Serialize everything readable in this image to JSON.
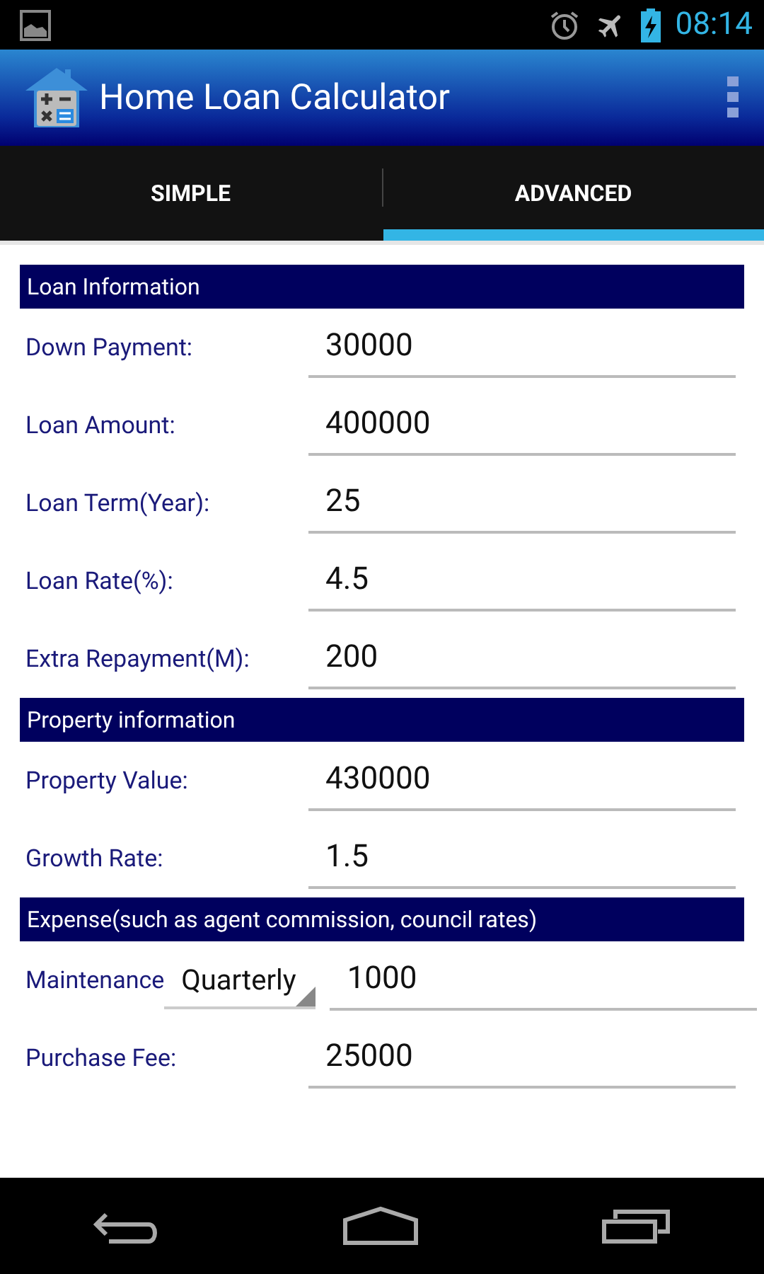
{
  "status_bar": {
    "time": "08:14"
  },
  "app_bar": {
    "title": "Home Loan Calculator"
  },
  "tabs": [
    {
      "label": "SIMPLE",
      "selected": false
    },
    {
      "label": "ADVANCED",
      "selected": true
    }
  ],
  "sections": [
    {
      "title": "Loan Information",
      "rows": [
        {
          "kind": "input",
          "label": "Down Payment:",
          "value": "30000"
        },
        {
          "kind": "input",
          "label": "Loan Amount:",
          "value": "400000"
        },
        {
          "kind": "input",
          "label": "Loan Term(Year):",
          "value": "25"
        },
        {
          "kind": "input",
          "label": "Loan Rate(%):",
          "value": "4.5"
        },
        {
          "kind": "input",
          "label": "Extra Repayment(M):",
          "value": "200"
        }
      ]
    },
    {
      "title": "Property information",
      "rows": [
        {
          "kind": "input",
          "label": "Property Value:",
          "value": "430000"
        },
        {
          "kind": "input",
          "label": "Growth Rate:",
          "value": "1.5"
        }
      ]
    },
    {
      "title": "Expense(such as agent commission, council rates)",
      "rows": [
        {
          "kind": "select_input",
          "label": "Maintenance",
          "option": "Quarterly",
          "value": "1000"
        },
        {
          "kind": "input",
          "label": "Purchase Fee:",
          "value": "25000"
        }
      ]
    }
  ]
}
